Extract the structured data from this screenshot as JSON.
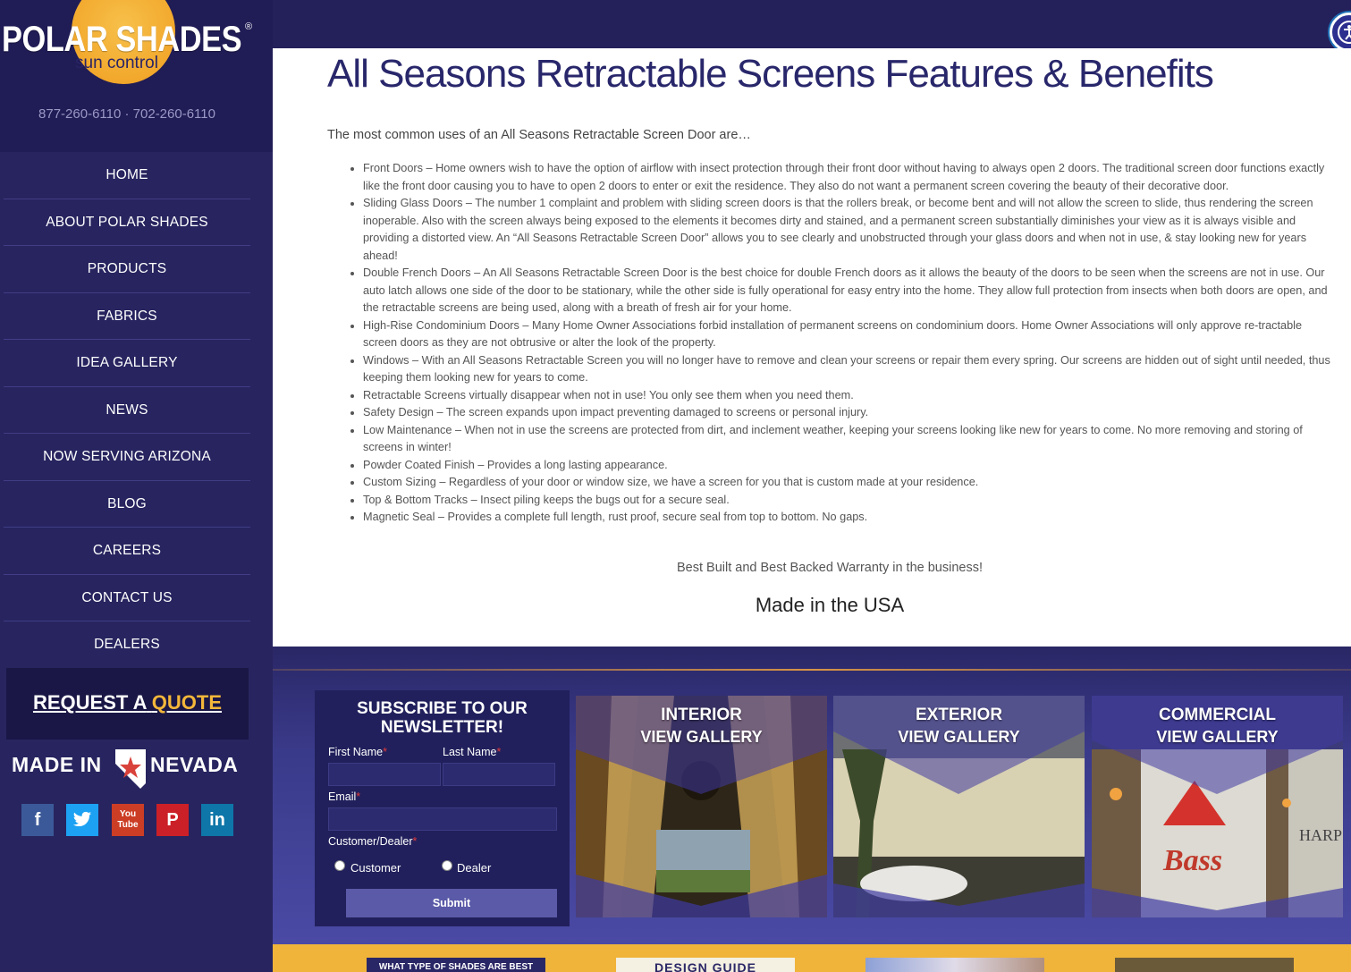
{
  "brand": {
    "name": "POLAR SHADES",
    "registered": "®",
    "tagline": "sun control",
    "phones": "877-260-6110 · 702-260-6110"
  },
  "nav": {
    "items": [
      {
        "label": "HOME"
      },
      {
        "label": "ABOUT POLAR SHADES"
      },
      {
        "label": "PRODUCTS"
      },
      {
        "label": "FABRICS"
      },
      {
        "label": "IDEA GALLERY"
      },
      {
        "label": "NEWS"
      },
      {
        "label": "NOW SERVING ARIZONA"
      },
      {
        "label": "BLOG"
      },
      {
        "label": "CAREERS"
      },
      {
        "label": "CONTACT US"
      },
      {
        "label": "DEALERS"
      }
    ]
  },
  "cta": {
    "quote_prefix": "REQUEST A",
    "quote_accent": "QUOTE"
  },
  "badge": {
    "made_in": "MADE IN",
    "state": "NEVADA"
  },
  "social": {
    "facebook": "f",
    "twitter": "🐦",
    "youtube": "You Tube",
    "pinterest": "P",
    "linkedin": "in"
  },
  "content": {
    "title": "All Seasons Retractable Screens Features & Benefits",
    "intro": "The most common uses of an All Seasons Retractable Screen Door are…",
    "bullets": [
      "Front Doors – Home owners wish to have the option of airflow with insect protection through their front door without having to always open 2 doors. The traditional screen door functions exactly like the front door causing you to have to open 2 doors to enter or exit the residence. They also do not want a permanent screen covering the beauty of their decorative door.",
      "Sliding Glass Doors – The number 1 complaint and problem with sliding screen doors is that the rollers break, or become bent and will not allow the screen to slide, thus rendering the screen inoperable. Also with the screen always being exposed to the elements it becomes dirty and stained, and a permanent screen substantially diminishes your view as it is always visible and providing a distorted view. An “All Seasons Retractable Screen Door” allows you to see clearly and unobstructed through your glass doors and when not in use, & stay looking new for years ahead!",
      "Double French Doors – An All Seasons Retractable Screen Door is the best choice for double French doors as it allows the beauty of the doors to be seen when the screens are not in use. Our auto latch allows one side of the door to be stationary, while the other side is fully operational for easy entry into the home. They allow full protection from insects when both doors are open, and the retractable screens are being used, along with a breath of fresh air for your home.",
      "High-Rise Condominium Doors – Many Home Owner Associations forbid installation of permanent screens on condominium doors. Home Owner Associations will only approve re-tractable screen doors as they are not obtrusive or alter the look of the property.",
      "Windows – With an All Seasons Retractable Screen you will no longer have to remove and clean your screens or repair them every spring. Our screens are hidden out of sight until needed, thus keeping them looking new for years to come.",
      "Retractable Screens virtually disappear when not in use! You only see them when you need them.",
      "Safety Design – The screen expands upon impact preventing damaged to screens or personal injury.",
      "Low Maintenance – When not in use the screens are protected from dirt, and inclement weather, keeping your screens looking like new for years to come. No more removing and storing of screens in winter!",
      "Powder Coated Finish – Provides a long lasting appearance.",
      "Custom Sizing – Regardless of your door or window size, we have a screen for you that is custom made at your residence.",
      "Top & Bottom Tracks – Insect piling keeps the bugs out for a secure seal.",
      "Magnetic Seal – Provides a complete full length, rust proof, secure seal from top to bottom. No gaps."
    ],
    "tagline": "Best Built and Best Backed Warranty in the business!",
    "made_in_usa": "Made in the USA"
  },
  "newsletter": {
    "title": "SUBSCRIBE TO OUR NEWSLETTER!",
    "first_name": "First Name",
    "last_name": "Last Name",
    "email": "Email",
    "customer_dealer": "Customer/Dealer",
    "required_mark": "*",
    "option_customer": "Customer",
    "option_dealer": "Dealer",
    "submit": "Submit"
  },
  "galleries": [
    {
      "title": "INTERIOR",
      "link": "VIEW GALLERY"
    },
    {
      "title": "EXTERIOR",
      "link": "VIEW GALLERY"
    },
    {
      "title": "COMMERCIAL",
      "link": "VIEW GALLERY"
    }
  ],
  "strip": {
    "card1": "WHAT TYPE OF SHADES ARE BEST",
    "card2": "DESIGN GUIDE"
  },
  "colors": {
    "sidebar_bg": "#27245f",
    "topbar_bg": "#24205a",
    "title_color": "#29276b",
    "accent": "#f4b73a"
  }
}
